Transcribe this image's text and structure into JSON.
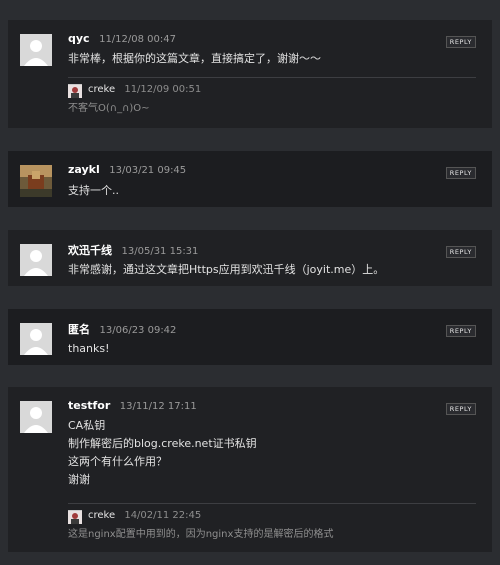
{
  "comments": [
    {
      "author": "qyc",
      "date": "11/12/08 00:47",
      "reply_label": "REPLY",
      "text": [
        "非常棒，根据你的这篇文章，直接搞定了，谢谢～～"
      ],
      "replies": [
        {
          "author": "creke",
          "date": "11/12/09 00:51",
          "text": "不客气O(∩_∩)O~"
        }
      ]
    },
    {
      "author": "zaykl",
      "date": "13/03/21 09:45",
      "reply_label": "REPLY",
      "text": [
        "支持一个.."
      ]
    },
    {
      "author": "欢迅千线",
      "date": "13/05/31 15:31",
      "reply_label": "REPLY",
      "text": [
        "非常感谢，通过这文章把Https应用到欢迅千线（joyit.me）上。"
      ]
    },
    {
      "author": "匿名",
      "date": "13/06/23 09:42",
      "reply_label": "REPLY",
      "text": [
        "thanks!"
      ]
    },
    {
      "author": "testfor",
      "date": "13/11/12 17:11",
      "reply_label": "REPLY",
      "text": [
        "CA私钥",
        "制作解密后的blog.creke.net证书私钥",
        "这两个有什么作用？",
        "谢谢"
      ],
      "replies": [
        {
          "author": "creke",
          "date": "14/02/11 22:45",
          "text": "这是nginx配置中用到的，因为nginx支持的是解密后的格式"
        }
      ]
    }
  ],
  "colors": {
    "page_bg": "#2b2d31",
    "comment_bg": "#202124",
    "author": "#ffffff",
    "date": "#9a9a9a"
  }
}
